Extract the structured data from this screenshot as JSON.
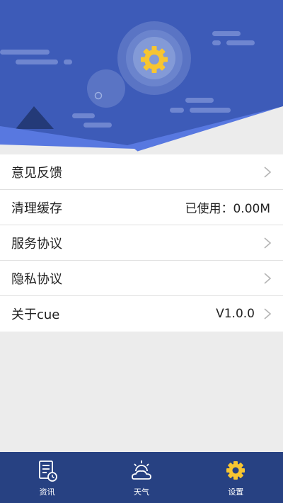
{
  "colors": {
    "hero_bg": "#3d5bb8",
    "accent_gear": "#f7c531",
    "tabbar_bg": "#274182",
    "row_bg": "#ffffff",
    "page_bg": "#ececec"
  },
  "header": {
    "illustration": "settings-gear-sky-illustration"
  },
  "settings": {
    "items": [
      {
        "label": "意见反馈",
        "value": "",
        "icon": "chevron-right-icon"
      },
      {
        "label": "清理缓存",
        "value": "已使用：0.00M",
        "icon": ""
      },
      {
        "label": "服务协议",
        "value": "",
        "icon": "chevron-right-icon"
      },
      {
        "label": "隐私协议",
        "value": "",
        "icon": "chevron-right-icon"
      },
      {
        "label": "关于cue",
        "value": "V1.0.0",
        "icon": "chevron-right-icon"
      }
    ]
  },
  "tabbar": {
    "tabs": [
      {
        "label": "资讯",
        "icon": "news-icon",
        "active": false
      },
      {
        "label": "天气",
        "icon": "weather-icon",
        "active": false
      },
      {
        "label": "设置",
        "icon": "gear-icon",
        "active": true
      }
    ]
  }
}
